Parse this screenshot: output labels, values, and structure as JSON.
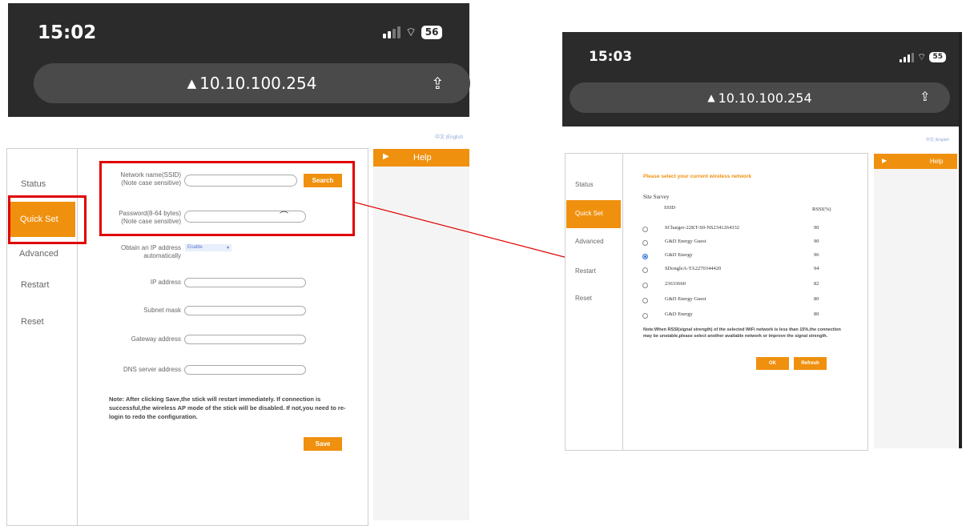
{
  "left": {
    "time": "15:02",
    "battery": "56",
    "url": "10.10.100.254",
    "lang_links": "中文 |English",
    "sidebar": [
      "Status",
      "Quick Set",
      "Advanced",
      "Restart",
      "Reset"
    ],
    "help_label": "Help",
    "form": {
      "ssid_label_1": "Network name(SSID)",
      "ssid_label_2": "(Note case sensitive)",
      "search_button": "Search",
      "password_label_1": "Password(8-64 bytes)",
      "password_label_2": "(Note case sensitive)",
      "dhcp_label_1": "Obtain an IP address",
      "dhcp_label_2": "automatically",
      "dhcp_value": "Enable",
      "ip_label": "IP address",
      "subnet_label": "Subnet mask",
      "gateway_label": "Gateway address",
      "dns_label": "DNS server address",
      "note": "Note: After clicking Save,the stick will restart immediately. If connection is successful,the wireless AP mode of the stick will be disabled. If not,you need to re-login to redo the configuration.",
      "save_button": "Save"
    }
  },
  "right": {
    "time": "15:03",
    "battery": "55",
    "url": "10.10.100.254",
    "lang_links": "中文 |English",
    "sidebar": [
      "Status",
      "Quick Set",
      "Advanced",
      "Restart",
      "Reset"
    ],
    "help_label": "Help",
    "heading": "Please select your current wireless network",
    "site_survey": "Site Survey",
    "col_ssid": "SSID",
    "col_rssi": "RSSI(%)",
    "networks": [
      {
        "ssid": "SCharger-22KT-S0-NS2341264332",
        "rssi": "90"
      },
      {
        "ssid": "G&D Energy Guest",
        "rssi": "90"
      },
      {
        "ssid": "G&D Energy",
        "rssi": "96"
      },
      {
        "ssid": "SDongleA-TA2270344420",
        "rssi": "94"
      },
      {
        "ssid": "23633660",
        "rssi": "82"
      },
      {
        "ssid": "G&D Energy Guest",
        "rssi": "80"
      },
      {
        "ssid": "G&D Energy",
        "rssi": "80"
      }
    ],
    "selected_index": 2,
    "note": "Note:When RSSI(signal strength) of the selected WiFi network is less than 15%,the connection may be unstable,please select another available network or improve the signal strength.",
    "ok_button": "OK",
    "refresh_button": "Refresh"
  },
  "colors": {
    "accent": "#f0900f",
    "highlight": "#e00000",
    "chrome": "#2b2b2b"
  }
}
